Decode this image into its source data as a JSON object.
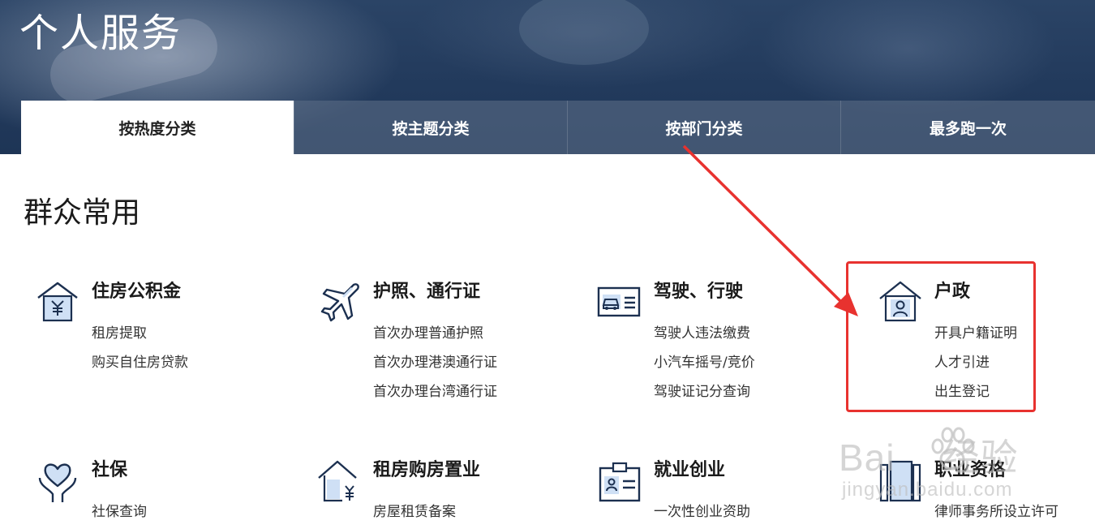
{
  "header": {
    "title": "个人服务",
    "tabs": [
      {
        "label": "按热度分类",
        "active": true
      },
      {
        "label": "按主题分类",
        "active": false
      },
      {
        "label": "按部门分类",
        "active": false
      },
      {
        "label": "最多跑一次",
        "active": false
      }
    ]
  },
  "section": {
    "title": "群众常用",
    "categories": [
      {
        "icon": "house-yuan-icon",
        "title": "住房公积金",
        "links": [
          "租房提取",
          "购买自住房贷款"
        ]
      },
      {
        "icon": "airplane-icon",
        "title": "护照、通行证",
        "links": [
          "首次办理普通护照",
          "首次办理港澳通行证",
          "首次办理台湾通行证"
        ]
      },
      {
        "icon": "car-license-icon",
        "title": "驾驶、行驶",
        "links": [
          "驾驶人违法缴费",
          "小汽车摇号/竞价",
          "驾驶证记分查询"
        ]
      },
      {
        "icon": "house-person-icon",
        "title": "户政",
        "links": [
          "开具户籍证明",
          "人才引进",
          "出生登记"
        ]
      },
      {
        "icon": "heart-hands-icon",
        "title": "社保",
        "links": [
          "社保查询"
        ]
      },
      {
        "icon": "house-arrow-yuan-icon",
        "title": "租房购房置业",
        "links": [
          "房屋租赁备案"
        ]
      },
      {
        "icon": "id-badge-icon",
        "title": "就业创业",
        "links": [
          "一次性创业资助"
        ]
      },
      {
        "icon": "qualification-icon",
        "title": "职业资格",
        "links": [
          "律师事务所设立许可"
        ]
      }
    ]
  },
  "annotation": {
    "highlight_color": "#e8322f"
  },
  "watermark": {
    "text": "Bai",
    "text_after": "经验",
    "url": "jingyan.baidu.com"
  },
  "colors": {
    "banner": "#223a5c",
    "tab_inactive": "#586a84",
    "icon_stroke": "#1c3050",
    "icon_fill": "#cfe0f5"
  }
}
